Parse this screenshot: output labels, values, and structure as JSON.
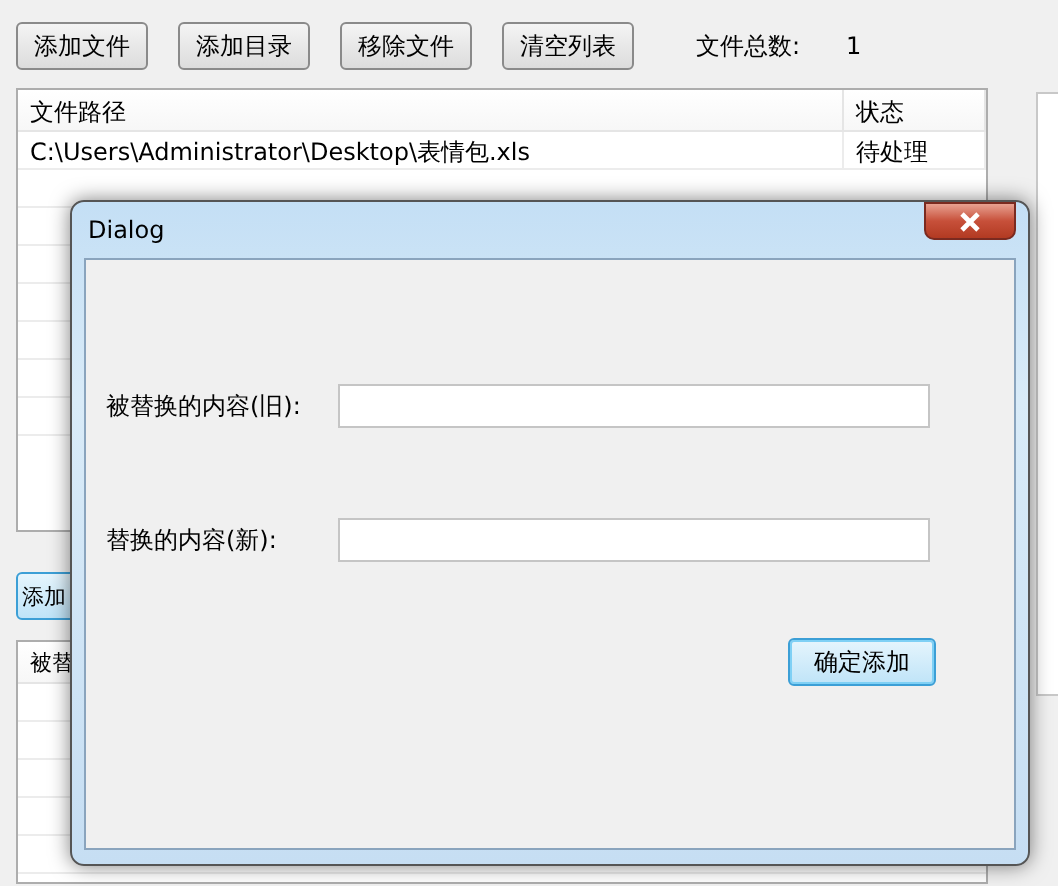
{
  "main": {
    "buttons": [
      {
        "label": "添加文件"
      },
      {
        "label": "添加目录"
      },
      {
        "label": "移除文件"
      },
      {
        "label": "清空列表"
      }
    ],
    "file_count": {
      "label": "文件总数:",
      "value": "1"
    },
    "file_table": {
      "columns": [
        "文件路径",
        "状态"
      ],
      "rows": [
        [
          "C:\\Users\\Administrator\\Desktop\\表情包.xls",
          "待处理"
        ]
      ]
    },
    "second_button": {
      "label": "添加",
      "highlighted": true
    },
    "replace_table": {
      "columns": [
        "被替"
      ]
    }
  },
  "dialog": {
    "title": "Dialog",
    "fields": [
      {
        "label": "被替换的内容(旧):"
      },
      {
        "label": "替换的内容(新):"
      }
    ],
    "confirm_button": {
      "label": "确定添加",
      "default": true
    }
  }
}
